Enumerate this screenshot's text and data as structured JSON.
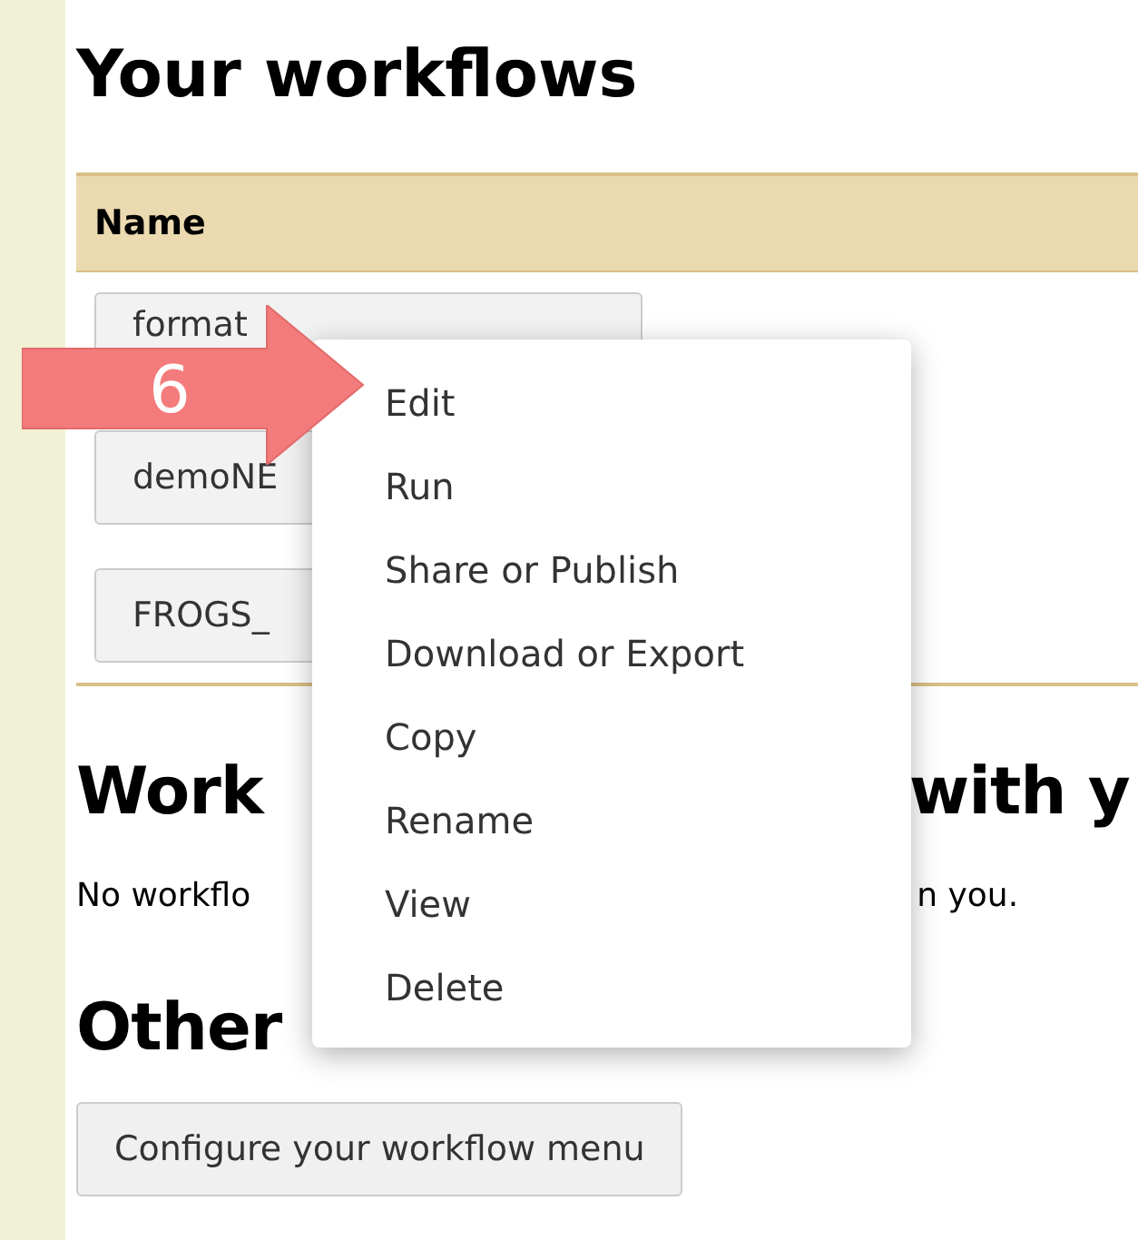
{
  "page_title": "Your workflows",
  "table": {
    "columns": [
      "Name"
    ],
    "rows": [
      {
        "name": "format"
      },
      {
        "name": "demoNE"
      },
      {
        "name": "FROGS_"
      }
    ]
  },
  "shared_section": {
    "title_left": "Work",
    "title_right": "with y",
    "text_left": "No workflo",
    "text_right": "n you."
  },
  "other_section": {
    "title": "Other",
    "button": "Configure your workflow menu"
  },
  "context_menu": {
    "items": [
      "Edit",
      "Run",
      "Share or Publish",
      "Download or Export",
      "Copy",
      "Rename",
      "View",
      "Delete"
    ]
  },
  "callout": {
    "number": "6"
  }
}
